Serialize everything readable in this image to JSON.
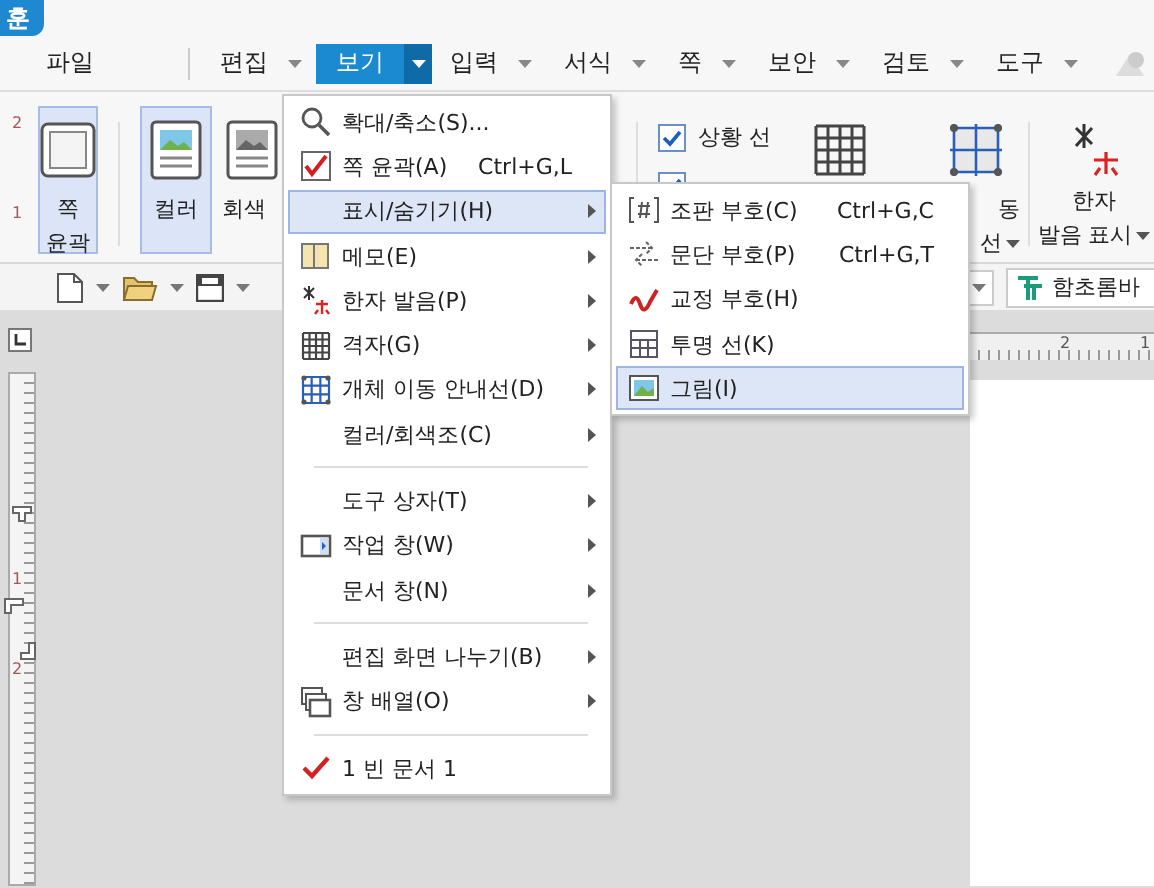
{
  "app_tab": {
    "label": "훈"
  },
  "menu_bar": [
    {
      "label": "파일",
      "selected": false,
      "dropdown": false
    },
    {
      "label": "편집",
      "selected": false,
      "dropdown": true
    },
    {
      "label": "보기",
      "selected": true,
      "dropdown": true
    },
    {
      "label": "입력",
      "selected": false,
      "dropdown": true
    },
    {
      "label": "서식",
      "selected": false,
      "dropdown": true
    },
    {
      "label": "쪽",
      "selected": false,
      "dropdown": true
    },
    {
      "label": "보안",
      "selected": false,
      "dropdown": true
    },
    {
      "label": "검토",
      "selected": false,
      "dropdown": true
    },
    {
      "label": "도구",
      "selected": false,
      "dropdown": true
    }
  ],
  "ribbon": {
    "buttons": [
      {
        "kind": "page",
        "lines": [
          "쪽",
          "윤곽"
        ],
        "selected": true
      },
      {
        "kind": "color",
        "lines": [
          "컬러"
        ],
        "selected": true
      },
      {
        "kind": "gray",
        "lines": [
          "회색"
        ],
        "selected": false
      }
    ],
    "checkboxes": [
      {
        "label": "상황 선",
        "checked": true
      },
      {
        "checked": true
      }
    ],
    "right_buttons": [
      {
        "kind": "grid"
      },
      {
        "kind": "guide",
        "lines": [
          "동",
          "선"
        ]
      },
      {
        "kind": "hanja",
        "lines": [
          "한자",
          "발음 표시"
        ]
      }
    ]
  },
  "toolbar": {
    "font": "함초롬바"
  },
  "view_menu": [
    {
      "label": "확대/축소(S)...",
      "kind": "zoom",
      "submenu": false,
      "selected": false,
      "checked": false,
      "separator_before": false
    },
    {
      "label": "쪽 윤곽(A)",
      "kind": "checkbox",
      "shortcut": "Ctrl+G,L",
      "submenu": false,
      "selected": false,
      "checked": true,
      "separator_before": false
    },
    {
      "label": "표시/숨기기(H)",
      "kind": "plain",
      "submenu": true,
      "selected": true,
      "checked": false,
      "separator_before": false
    },
    {
      "label": "메모(E)",
      "kind": "memo",
      "submenu": true,
      "selected": false,
      "checked": false,
      "separator_before": false
    },
    {
      "label": "한자 발음(P)",
      "kind": "hanja",
      "submenu": true,
      "selected": false,
      "checked": false,
      "separator_before": false
    },
    {
      "label": "격자(G)",
      "kind": "grid",
      "submenu": true,
      "selected": false,
      "checked": false,
      "separator_before": false
    },
    {
      "label": "개체 이동 안내선(D)",
      "kind": "guide",
      "submenu": true,
      "selected": false,
      "checked": false,
      "separator_before": false
    },
    {
      "label": "컬러/회색조(C)",
      "kind": "plain",
      "submenu": true,
      "selected": false,
      "checked": false,
      "separator_before": false
    },
    {
      "label": "도구 상자(T)",
      "kind": "plain",
      "submenu": true,
      "selected": false,
      "checked": false,
      "separator_before": true
    },
    {
      "label": "작업 창(W)",
      "kind": "taskpane",
      "submenu": true,
      "selected": false,
      "checked": false,
      "separator_before": false
    },
    {
      "label": "문서 창(N)",
      "kind": "plain",
      "submenu": true,
      "selected": false,
      "checked": false,
      "separator_before": false
    },
    {
      "label": "편집 화면 나누기(B)",
      "kind": "plain",
      "submenu": true,
      "selected": false,
      "checked": false,
      "separator_before": true
    },
    {
      "label": "창 배열(O)",
      "kind": "arrange",
      "submenu": true,
      "selected": false,
      "checked": false,
      "separator_before": false
    },
    {
      "label": "1 빈 문서 1",
      "kind": "plain",
      "submenu": false,
      "selected": false,
      "checked": true,
      "separator_before": true
    }
  ],
  "show_hide_submenu": [
    {
      "label": "조판 부호(C)",
      "kind": "marks",
      "shortcut": "Ctrl+G,C",
      "selected": false
    },
    {
      "label": "문단 부호(P)",
      "kind": "para",
      "shortcut": "Ctrl+G,T",
      "selected": false
    },
    {
      "label": "교정 부호(H)",
      "kind": "proof",
      "selected": false
    },
    {
      "label": "투명 선(K)",
      "kind": "table",
      "selected": false
    },
    {
      "label": "그림(I)",
      "kind": "picture",
      "selected": true
    }
  ],
  "ruler": {
    "top_labels": [
      "2",
      "1"
    ],
    "side_labels": [
      "2",
      "1",
      "1",
      "2"
    ]
  }
}
